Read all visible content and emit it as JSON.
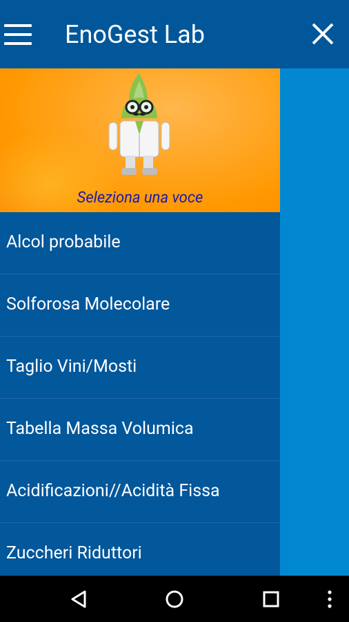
{
  "appbar": {
    "title": "EnoGest Lab",
    "menu_icon": "hamburger-menu-icon",
    "close_icon": "close-icon",
    "background_color": "#02579a"
  },
  "drawer": {
    "header": {
      "caption": "Seleziona una voce",
      "mascot_icon": "lab-scientist-mascot-icon"
    },
    "items": [
      {
        "label": "Alcol probabile"
      },
      {
        "label": "Solforosa Molecolare"
      },
      {
        "label": "Taglio Vini/Mosti"
      },
      {
        "label": "Tabella Massa Volumica"
      },
      {
        "label": "Acidificazioni//Acidità Fissa"
      },
      {
        "label": "Zuccheri Riduttori"
      }
    ],
    "background_color": "#03579b"
  },
  "navbar": {
    "icons": [
      "back-icon",
      "home-icon",
      "recents-icon",
      "more-options-icon"
    ]
  }
}
